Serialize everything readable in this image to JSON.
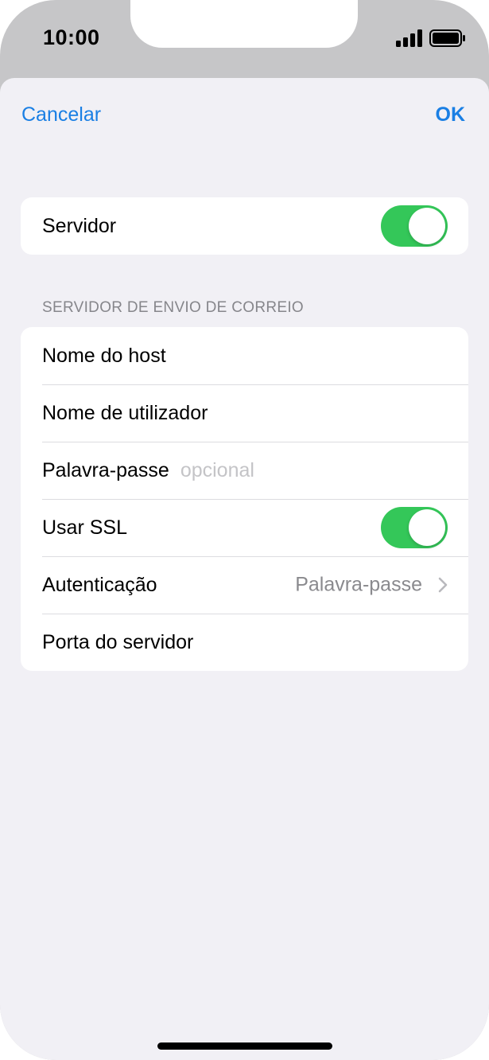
{
  "status_bar": {
    "time": "10:00",
    "icons": [
      "cellular-signal-icon",
      "battery-icon"
    ]
  },
  "nav": {
    "cancel_label": "Cancelar",
    "ok_label": "OK"
  },
  "server_group": {
    "label": "Servidor",
    "toggle_on": true
  },
  "outgoing_section": {
    "header": "SERVIDOR DE ENVIO DE CORREIO",
    "hostname_label": "Nome do host",
    "username_label": "Nome de utilizador",
    "password_label": "Palavra-passe",
    "password_placeholder": "opcional",
    "ssl_label": "Usar SSL",
    "ssl_on": true,
    "auth_label": "Autenticação",
    "auth_value": "Palavra-passe",
    "port_label": "Porta do servidor"
  },
  "colors": {
    "accent": "#1a7fe4",
    "toggle_on": "#34c759",
    "background": "#f1f0f5"
  }
}
